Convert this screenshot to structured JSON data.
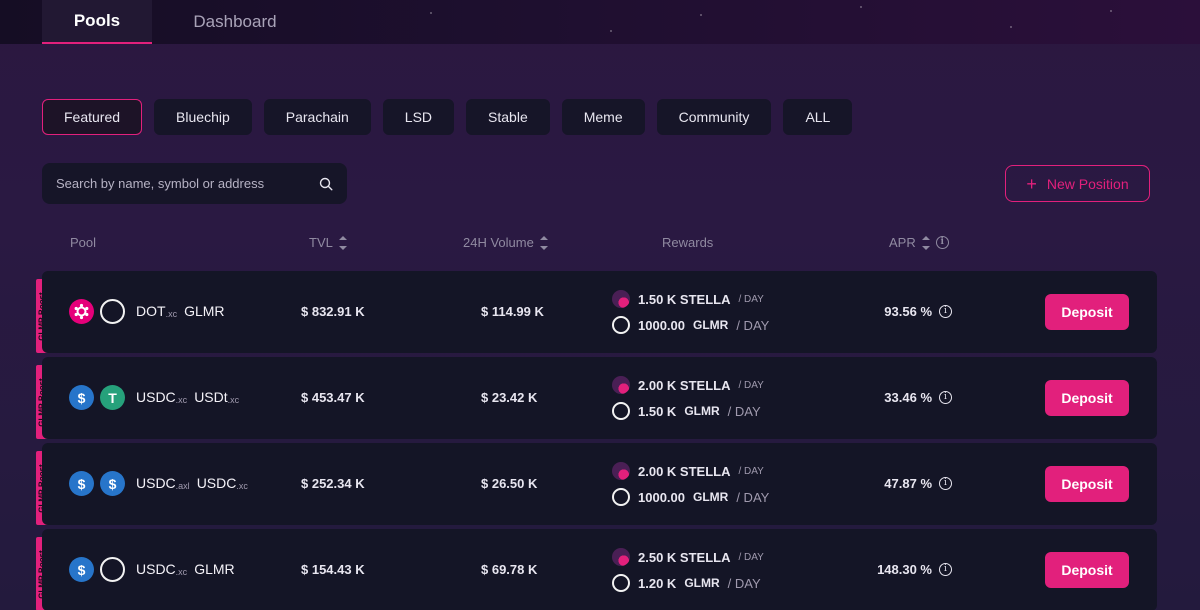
{
  "nav": {
    "tabs": [
      "Pools",
      "Dashboard"
    ]
  },
  "categories": [
    "Featured",
    "Bluechip",
    "Parachain",
    "LSD",
    "Stable",
    "Meme",
    "Community",
    "ALL"
  ],
  "search": {
    "placeholder": "Search by name, symbol or address"
  },
  "new_position_label": "New Position",
  "columns": {
    "pool": "Pool",
    "tvl": "TVL",
    "volume": "24H Volume",
    "rewards": "Rewards",
    "apr": "APR"
  },
  "accent_color": "#e2207c",
  "pools": [
    {
      "boost": "GLMR Boost",
      "token_a": "DOT",
      "token_a_suffix": ".xc",
      "token_b": "GLMR",
      "token_b_suffix": "",
      "icons": [
        "polkadot-icon",
        "moonbeam-icon"
      ],
      "tvl": "$ 832.91 K",
      "volume": "$ 114.99 K",
      "reward1_amount": "1.50 K STELLA",
      "reward1_per": "/ DAY",
      "reward2_amount": "1000.00",
      "reward2_unit": "GLMR",
      "reward2_per": "/ DAY",
      "apr": "93.56 %",
      "action": "Deposit"
    },
    {
      "boost": "GLMR Boost",
      "token_a": "USDC",
      "token_a_suffix": ".xc",
      "token_b": "USDt",
      "token_b_suffix": ".xc",
      "icons": [
        "usdc-icon",
        "usdt-icon"
      ],
      "tvl": "$ 453.47 K",
      "volume": "$ 23.42 K",
      "reward1_amount": "2.00 K STELLA",
      "reward1_per": "/ DAY",
      "reward2_amount": "1.50 K",
      "reward2_unit": "GLMR",
      "reward2_per": "/ DAY",
      "apr": "33.46 %",
      "action": "Deposit"
    },
    {
      "boost": "GLMR Boost",
      "token_a": "USDC",
      "token_a_suffix": ".axl",
      "token_b": "USDC",
      "token_b_suffix": ".xc",
      "icons": [
        "usdc-icon",
        "usdc-icon"
      ],
      "tvl": "$ 252.34 K",
      "volume": "$ 26.50 K",
      "reward1_amount": "2.00 K STELLA",
      "reward1_per": "/ DAY",
      "reward2_amount": "1000.00",
      "reward2_unit": "GLMR",
      "reward2_per": "/ DAY",
      "apr": "47.87 %",
      "action": "Deposit"
    },
    {
      "boost": "GLMR Boost",
      "token_a": "USDC",
      "token_a_suffix": ".xc",
      "token_b": "GLMR",
      "token_b_suffix": "",
      "icons": [
        "usdc-icon",
        "moonbeam-icon"
      ],
      "tvl": "$ 154.43 K",
      "volume": "$ 69.78 K",
      "reward1_amount": "2.50 K STELLA",
      "reward1_per": "/ DAY",
      "reward2_amount": "1.20 K",
      "reward2_unit": "GLMR",
      "reward2_per": "/ DAY",
      "apr": "148.30 %",
      "action": "Deposit"
    }
  ]
}
